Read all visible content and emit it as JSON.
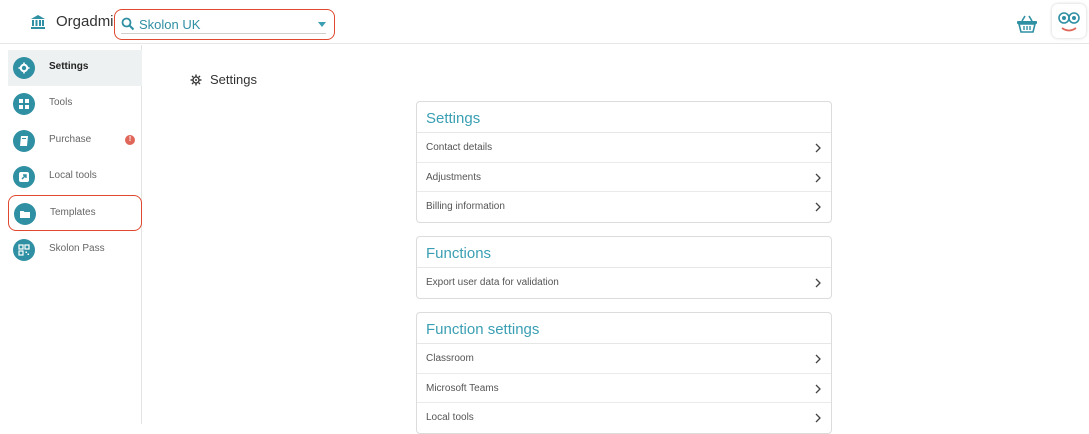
{
  "header": {
    "title": "Orgadmin",
    "org_select": {
      "value": "Skolon UK"
    },
    "icons": [
      "institution-icon",
      "search-icon",
      "caret-down-icon",
      "basket-icon",
      "skolon-avatar"
    ]
  },
  "sidebar": {
    "items": [
      {
        "label": "Settings",
        "icon": "gear-icon",
        "active": true
      },
      {
        "label": "Tools",
        "icon": "grid-icon"
      },
      {
        "label": "Purchase",
        "icon": "book-icon",
        "badge": "!"
      },
      {
        "label": "Local tools",
        "icon": "external-link-icon"
      },
      {
        "label": "Templates",
        "icon": "folder-icon"
      },
      {
        "label": "Skolon Pass",
        "icon": "qr-icon"
      }
    ]
  },
  "main": {
    "title": "Settings",
    "cards": [
      {
        "title": "Settings",
        "rows": [
          "Contact details",
          "Adjustments",
          "Billing information"
        ]
      },
      {
        "title": "Functions",
        "rows": [
          "Export user data for validation"
        ]
      },
      {
        "title": "Function settings",
        "rows": [
          "Classroom",
          "Microsoft Teams",
          "Local tools"
        ]
      }
    ]
  },
  "colors": {
    "accent": "#2f8fa3",
    "highlight": "#e0492f",
    "badge": "#e0665a"
  }
}
